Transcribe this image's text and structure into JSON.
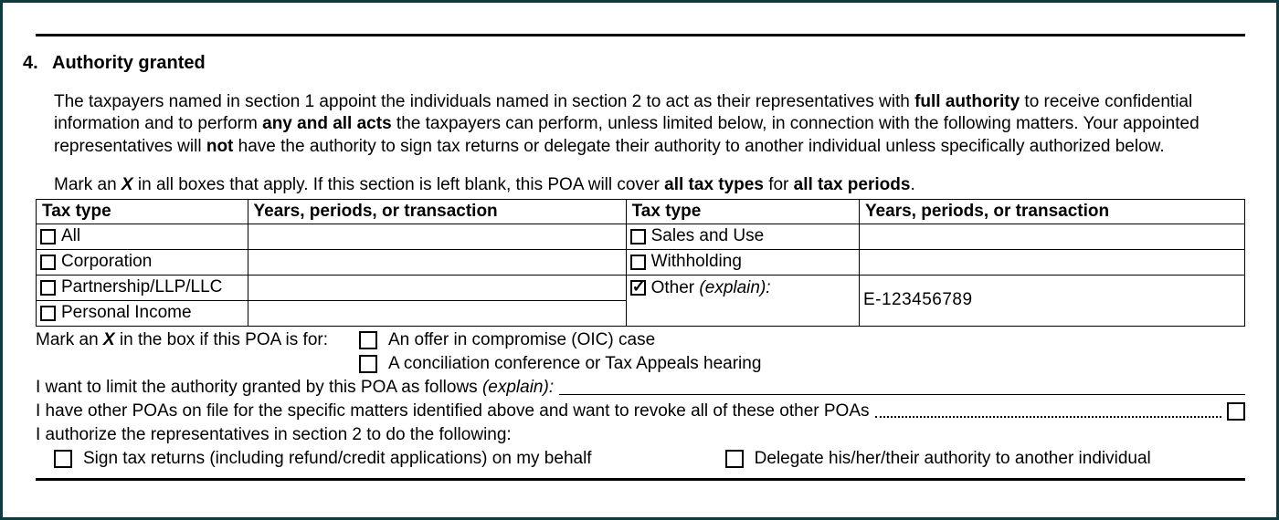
{
  "section": {
    "number": "4.",
    "title": "Authority granted"
  },
  "para": {
    "p1_a": "The taxpayers named in section 1 appoint the individuals named in section 2 to act as their representatives with ",
    "p1_b": "full authority",
    "p1_c": " to receive confidential information and to perform ",
    "p1_d": "any and all acts",
    "p1_e": " the taxpayers can perform, unless limited below, in connection with the following matters. Your appointed representatives will ",
    "p1_f": "not",
    "p1_g": " have the authority to sign tax returns or delegate their authority to another individual unless specifically authorized below."
  },
  "instr": {
    "a": "Mark an ",
    "x": "X",
    "b": " in all boxes that apply. If this section is left blank, this POA will cover ",
    "c": "all tax types",
    "d": " for ",
    "e": "all tax periods",
    "f": "."
  },
  "headers": {
    "tax_type": "Tax type",
    "years": "Years, periods, or transaction"
  },
  "left_rows": [
    {
      "label": "All"
    },
    {
      "label": "Corporation"
    },
    {
      "label": "Partnership/LLP/LLC"
    },
    {
      "label": "Personal Income"
    }
  ],
  "right_rows": [
    {
      "label": "Sales and Use"
    },
    {
      "label": "Withholding"
    },
    {
      "label": "Other ",
      "italic": "(explain):",
      "checked": true
    }
  ],
  "explain_value": "E-123456789",
  "oic": {
    "lead": "Mark an ",
    "x": "X",
    "lead2": " in the box if this POA is for:",
    "opt1": "An offer in compromise (OIC) case",
    "opt2": "A conciliation conference or Tax Appeals hearing"
  },
  "limit": {
    "text": "I want to limit the authority granted by this POA as follows ",
    "italic": "(explain):"
  },
  "revoke": "I have other POAs on file for the specific matters identified above and want to revoke all of these other POAs",
  "authorize_lead": "I authorize the representatives in section 2 to do the following:",
  "auth_opts": {
    "sign": "Sign tax returns (including refund/credit applications) on my behalf",
    "delegate": "Delegate his/her/their authority to another individual"
  }
}
